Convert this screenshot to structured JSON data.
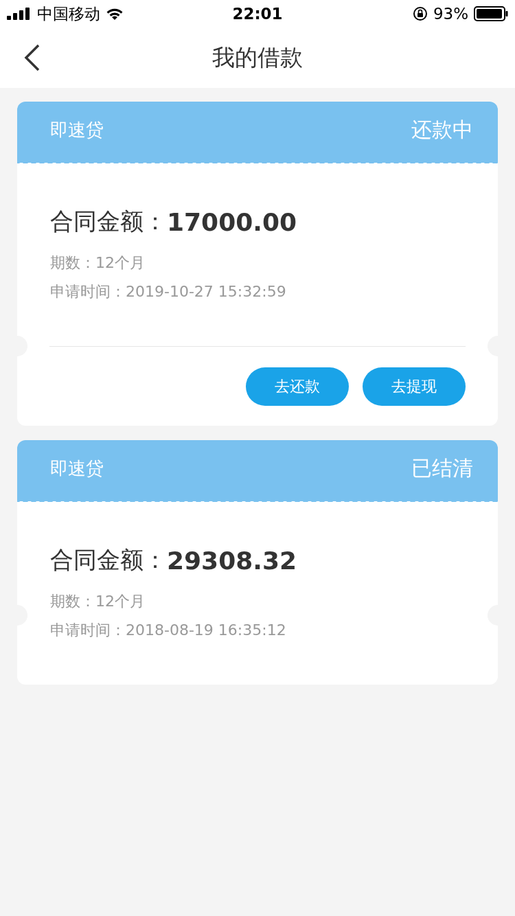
{
  "status_bar": {
    "carrier": "中国移动",
    "time": "22:01",
    "battery": "93%"
  },
  "nav": {
    "title": "我的借款"
  },
  "loans": [
    {
      "product": "即速贷",
      "status": "还款中",
      "amount_label": "合同金额：",
      "amount": "17000.00",
      "term": "期数：12个月",
      "applied": "申请时间：2019-10-27 15:32:59",
      "buttons": [
        "去还款",
        "去提现"
      ]
    },
    {
      "product": "即速贷",
      "status": "已结清",
      "amount_label": "合同金额：",
      "amount": "29308.32",
      "term": "期数：12个月",
      "applied": "申请时间：2018-08-19 16:35:12"
    }
  ]
}
